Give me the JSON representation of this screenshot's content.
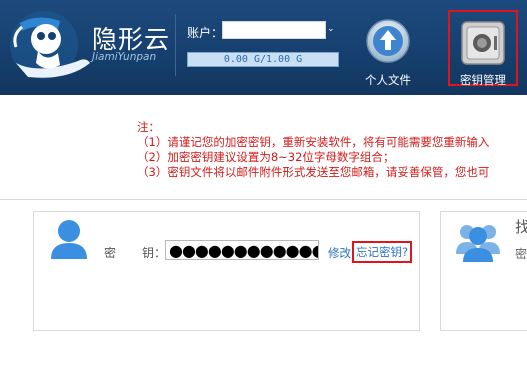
{
  "header": {
    "brand_cn": "隐形云",
    "brand_en": "JiamiYunpan",
    "account_label": "账户：",
    "account_value": "",
    "quota": "0.00 G/1.00 G",
    "nav": [
      {
        "label": "个人文件",
        "icon": "upload-arrow-icon"
      },
      {
        "label": "密钥管理",
        "icon": "safe-icon",
        "active": true
      }
    ]
  },
  "notes": {
    "title": "注：",
    "items": [
      "（1）请谨记您的加密密钥，重新安装软件，将有可能需要您重新输入",
      "（2）加密密钥建议设置为8~32位字母数字组合；",
      "（3）密钥文件将以邮件附件形式发送至您邮箱，请妥善保管，您也可"
    ]
  },
  "key_panel": {
    "label_a": "密",
    "label_b": "钥：",
    "key_mask": "●●●●●●●●●●●●●",
    "modify": "修改",
    "forgot": "忘记密钥?"
  },
  "find_panel": {
    "title": "找",
    "label": "密"
  },
  "colors": {
    "header": "#16406f",
    "note_red": "#d61a1a",
    "link": "#2a74c0",
    "highlight": "#e0141b"
  }
}
